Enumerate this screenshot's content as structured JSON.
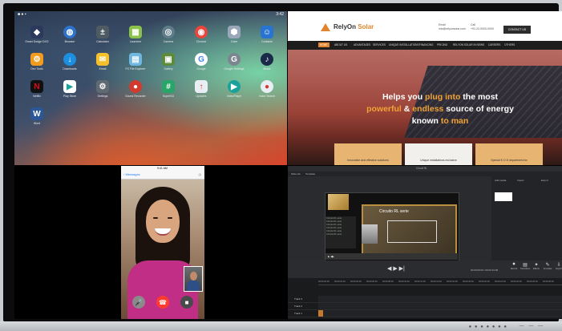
{
  "colors": {
    "accent_orange": "#e2842b",
    "play_green": "#1aa29a",
    "record_red": "#e23b3b"
  },
  "android": {
    "status_time": "3:42",
    "apps": [
      {
        "label": "Smart Dodge DXG",
        "icon": "game-icon",
        "color": "#2b3a5c"
      },
      {
        "label": "Browser",
        "icon": "globe-icon",
        "color": "#2f72c9"
      },
      {
        "label": "Calculator",
        "icon": "calculator-icon",
        "color": "#4e5b62"
      },
      {
        "label": "Launcher",
        "icon": "launcher-icon",
        "color": "#8bc34a"
      },
      {
        "label": "Camera",
        "icon": "camera-icon",
        "color": "#607d8b"
      },
      {
        "label": "Chrome",
        "icon": "chrome-icon",
        "color": "#e8453c"
      },
      {
        "label": "Cube",
        "icon": "cube-icon",
        "color": "#9aa7b8"
      },
      {
        "label": "Contacts",
        "icon": "contacts-icon",
        "color": "#2a74d1"
      },
      {
        "label": "Dev Tools",
        "icon": "gear-icon",
        "color": "#f29c1f"
      },
      {
        "label": "Downloads",
        "icon": "download-icon",
        "color": "#1d8fe0"
      },
      {
        "label": "Email",
        "icon": "email-icon",
        "color": "#f5c02b"
      },
      {
        "label": "FX File Explorer",
        "icon": "folder-icon",
        "color": "#6fb7e0"
      },
      {
        "label": "Gallery",
        "icon": "gallery-icon",
        "color": "#5c8b3b"
      },
      {
        "label": "Google",
        "icon": "google-icon",
        "color": "#ffffff"
      },
      {
        "label": "Google Settings",
        "icon": "settings-g-icon",
        "color": "#7c8690"
      },
      {
        "label": "Music",
        "icon": "music-icon",
        "color": "#1c2a4a"
      },
      {
        "label": "Netflix",
        "icon": "netflix-icon",
        "color": "#111111"
      },
      {
        "label": "Play Store",
        "icon": "play-store-icon",
        "color": "#ffffff"
      },
      {
        "label": "Settings",
        "icon": "settings-icon",
        "color": "#5f6a73"
      },
      {
        "label": "Sound Recorder",
        "icon": "microphone-icon",
        "color": "#d23a2e"
      },
      {
        "label": "SuperSU",
        "icon": "hash-icon",
        "color": "#2aa56a"
      },
      {
        "label": "Updates",
        "icon": "update-icon",
        "color": "#e8eef3"
      },
      {
        "label": "VideoPlayer",
        "icon": "video-icon",
        "color": "#1aa29a"
      },
      {
        "label": "Voice Search",
        "icon": "voice-icon",
        "color": "#e8eef3"
      },
      {
        "label": "Word",
        "icon": "word-icon",
        "color": "#2b5797"
      }
    ]
  },
  "website": {
    "brand_prefix": "RelyOn",
    "brand_suffix": "Solar",
    "contact_email_label": "Email",
    "contact_email": "info@relyonsolar.com",
    "contact_phone_label": "Call",
    "contact_phone": "+91-22-0000-0000",
    "contact_button": "CONTACT US",
    "nav": [
      "HOME",
      "ABOUT US",
      "ADVANTAGES",
      "SERVICES",
      "UNIQUE INSTALLATIONS",
      "FINANCING",
      "PRICING",
      "RELYON SOLAR IN NEWS",
      "CAREERS",
      "OTHERS"
    ],
    "hero_line1_a": "Helps you ",
    "hero_line1_b": "plug into",
    "hero_line1_c": " the most",
    "hero_line2_a": "powerful",
    "hero_line2_b": " & ",
    "hero_line2_c": "endless",
    "hero_line2_d": " source of energy",
    "hero_line3_a": "known",
    "hero_line3_b": " to man",
    "cards": [
      "Innovative and effective solutions",
      "Unique installations exclusive",
      "Special E.O.S department for"
    ]
  },
  "messages": {
    "status_time": "9:41 AM",
    "back_label": "Messages",
    "info_label": "(i)"
  },
  "editor": {
    "title": "Circuit RL",
    "tabs": [
      "Slide tab",
      "Template"
    ],
    "slide_title": "Circuito RL serie",
    "slide_list": [
      "Circuito RL serie",
      "Circuito RL serie",
      "Circuito RL serie",
      "Circuito RL serie",
      "Circuito RL serie",
      "Circuito RL serie"
    ],
    "timecode": "00:00:00:00 / 00:00:21:00",
    "right_panel_items": [
      "Add media",
      "Import",
      "Export"
    ],
    "tools": [
      {
        "label": "Record",
        "icon": "record-icon"
      },
      {
        "label": "Transitions",
        "icon": "transition-icon"
      },
      {
        "label": "Effects",
        "icon": "effects-icon"
      },
      {
        "label": "Annotate",
        "icon": "pen-icon"
      },
      {
        "label": "Export",
        "icon": "export-icon"
      }
    ],
    "ruler_labels": [
      "00:00:00:00",
      "00:00:02:00",
      "00:00:04:00",
      "00:00:06:00",
      "00:00:08:00",
      "00:00:10:00",
      "00:00:12:00",
      "00:00:14:00",
      "00:00:16:00",
      "00:00:18:00",
      "00:00:20:00",
      "00:00:22:00",
      "00:00:24:00",
      "00:00:26:00",
      "00:00:28:00"
    ],
    "tracks": [
      "Track 3",
      "Track 2",
      "Track 1"
    ]
  }
}
